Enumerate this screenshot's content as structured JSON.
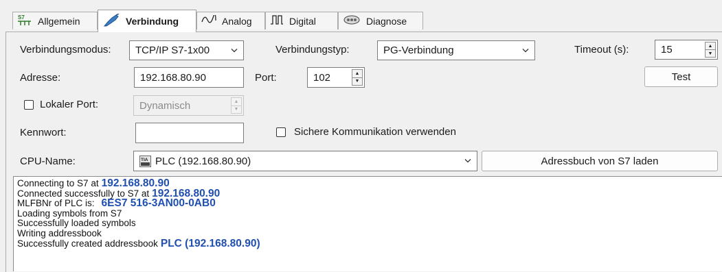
{
  "tabs": [
    {
      "label": "Allgemein",
      "icon": "s7-icon",
      "active": false
    },
    {
      "label": "Verbindung",
      "icon": "plug-icon",
      "active": true
    },
    {
      "label": "Analog",
      "icon": "analog-wave-icon",
      "active": false
    },
    {
      "label": "Digital",
      "icon": "digital-signal-icon",
      "active": false
    },
    {
      "label": "Diagnose",
      "icon": "diagnose-icon",
      "active": false
    }
  ],
  "form": {
    "mode_label": "Verbindungsmodus:",
    "mode_value": "TCP/IP S7-1x00",
    "type_label": "Verbindungstyp:",
    "type_value": "PG-Verbindung",
    "timeout_label": "Timeout (s):",
    "timeout_value": "15",
    "address_label": "Adresse:",
    "address_value": "192.168.80.90",
    "port_label": "Port:",
    "port_value": "102",
    "test_button": "Test",
    "local_port_label": "Lokaler Port:",
    "local_port_checked": false,
    "local_port_value": "Dynamisch",
    "password_label": "Kennwort:",
    "password_value": "",
    "secure_label": "Sichere Kommunikation verwenden",
    "secure_checked": false,
    "cpu_label": "CPU-Name:",
    "cpu_value": "PLC (192.168.80.90)",
    "cpu_icon": "tia-portal-icon",
    "addressbook_button": "Adressbuch von S7 laden"
  },
  "log": [
    {
      "text": "Connecting to S7 at",
      "highlight": "192.168.80.90"
    },
    {
      "text": "Connected successfully to S7 at",
      "highlight": "192.168.80.90"
    },
    {
      "text": "MLFBNr of PLC is:",
      "highlight": "6ES7 516-3AN00-0AB0"
    },
    {
      "text": "Loading symbols from S7",
      "highlight": ""
    },
    {
      "text": "Successfully loaded symbols",
      "highlight": ""
    },
    {
      "text": "Writing addressbook",
      "highlight": ""
    },
    {
      "text": "Successfully created addressbook",
      "highlight": "PLC (192.168.80.90)"
    }
  ],
  "colors": {
    "highlight": "#1f4fb0",
    "tab_active": "#ffffff",
    "background": "#f0f0f0"
  }
}
